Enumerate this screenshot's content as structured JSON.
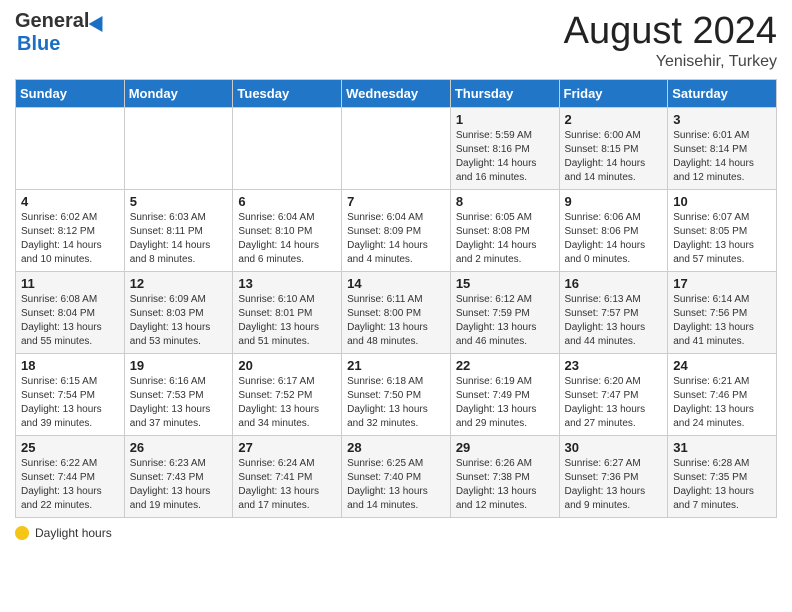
{
  "header": {
    "logo_general": "General",
    "logo_blue": "Blue",
    "month": "August 2024",
    "location": "Yenisehir, Turkey"
  },
  "days_of_week": [
    "Sunday",
    "Monday",
    "Tuesday",
    "Wednesday",
    "Thursday",
    "Friday",
    "Saturday"
  ],
  "weeks": [
    [
      {
        "day": "",
        "info": ""
      },
      {
        "day": "",
        "info": ""
      },
      {
        "day": "",
        "info": ""
      },
      {
        "day": "",
        "info": ""
      },
      {
        "day": "1",
        "info": "Sunrise: 5:59 AM\nSunset: 8:16 PM\nDaylight: 14 hours and 16 minutes."
      },
      {
        "day": "2",
        "info": "Sunrise: 6:00 AM\nSunset: 8:15 PM\nDaylight: 14 hours and 14 minutes."
      },
      {
        "day": "3",
        "info": "Sunrise: 6:01 AM\nSunset: 8:14 PM\nDaylight: 14 hours and 12 minutes."
      }
    ],
    [
      {
        "day": "4",
        "info": "Sunrise: 6:02 AM\nSunset: 8:12 PM\nDaylight: 14 hours and 10 minutes."
      },
      {
        "day": "5",
        "info": "Sunrise: 6:03 AM\nSunset: 8:11 PM\nDaylight: 14 hours and 8 minutes."
      },
      {
        "day": "6",
        "info": "Sunrise: 6:04 AM\nSunset: 8:10 PM\nDaylight: 14 hours and 6 minutes."
      },
      {
        "day": "7",
        "info": "Sunrise: 6:04 AM\nSunset: 8:09 PM\nDaylight: 14 hours and 4 minutes."
      },
      {
        "day": "8",
        "info": "Sunrise: 6:05 AM\nSunset: 8:08 PM\nDaylight: 14 hours and 2 minutes."
      },
      {
        "day": "9",
        "info": "Sunrise: 6:06 AM\nSunset: 8:06 PM\nDaylight: 14 hours and 0 minutes."
      },
      {
        "day": "10",
        "info": "Sunrise: 6:07 AM\nSunset: 8:05 PM\nDaylight: 13 hours and 57 minutes."
      }
    ],
    [
      {
        "day": "11",
        "info": "Sunrise: 6:08 AM\nSunset: 8:04 PM\nDaylight: 13 hours and 55 minutes."
      },
      {
        "day": "12",
        "info": "Sunrise: 6:09 AM\nSunset: 8:03 PM\nDaylight: 13 hours and 53 minutes."
      },
      {
        "day": "13",
        "info": "Sunrise: 6:10 AM\nSunset: 8:01 PM\nDaylight: 13 hours and 51 minutes."
      },
      {
        "day": "14",
        "info": "Sunrise: 6:11 AM\nSunset: 8:00 PM\nDaylight: 13 hours and 48 minutes."
      },
      {
        "day": "15",
        "info": "Sunrise: 6:12 AM\nSunset: 7:59 PM\nDaylight: 13 hours and 46 minutes."
      },
      {
        "day": "16",
        "info": "Sunrise: 6:13 AM\nSunset: 7:57 PM\nDaylight: 13 hours and 44 minutes."
      },
      {
        "day": "17",
        "info": "Sunrise: 6:14 AM\nSunset: 7:56 PM\nDaylight: 13 hours and 41 minutes."
      }
    ],
    [
      {
        "day": "18",
        "info": "Sunrise: 6:15 AM\nSunset: 7:54 PM\nDaylight: 13 hours and 39 minutes."
      },
      {
        "day": "19",
        "info": "Sunrise: 6:16 AM\nSunset: 7:53 PM\nDaylight: 13 hours and 37 minutes."
      },
      {
        "day": "20",
        "info": "Sunrise: 6:17 AM\nSunset: 7:52 PM\nDaylight: 13 hours and 34 minutes."
      },
      {
        "day": "21",
        "info": "Sunrise: 6:18 AM\nSunset: 7:50 PM\nDaylight: 13 hours and 32 minutes."
      },
      {
        "day": "22",
        "info": "Sunrise: 6:19 AM\nSunset: 7:49 PM\nDaylight: 13 hours and 29 minutes."
      },
      {
        "day": "23",
        "info": "Sunrise: 6:20 AM\nSunset: 7:47 PM\nDaylight: 13 hours and 27 minutes."
      },
      {
        "day": "24",
        "info": "Sunrise: 6:21 AM\nSunset: 7:46 PM\nDaylight: 13 hours and 24 minutes."
      }
    ],
    [
      {
        "day": "25",
        "info": "Sunrise: 6:22 AM\nSunset: 7:44 PM\nDaylight: 13 hours and 22 minutes."
      },
      {
        "day": "26",
        "info": "Sunrise: 6:23 AM\nSunset: 7:43 PM\nDaylight: 13 hours and 19 minutes."
      },
      {
        "day": "27",
        "info": "Sunrise: 6:24 AM\nSunset: 7:41 PM\nDaylight: 13 hours and 17 minutes."
      },
      {
        "day": "28",
        "info": "Sunrise: 6:25 AM\nSunset: 7:40 PM\nDaylight: 13 hours and 14 minutes."
      },
      {
        "day": "29",
        "info": "Sunrise: 6:26 AM\nSunset: 7:38 PM\nDaylight: 13 hours and 12 minutes."
      },
      {
        "day": "30",
        "info": "Sunrise: 6:27 AM\nSunset: 7:36 PM\nDaylight: 13 hours and 9 minutes."
      },
      {
        "day": "31",
        "info": "Sunrise: 6:28 AM\nSunset: 7:35 PM\nDaylight: 13 hours and 7 minutes."
      }
    ]
  ],
  "footer": {
    "sun_icon": "sun",
    "label": "Daylight hours"
  }
}
